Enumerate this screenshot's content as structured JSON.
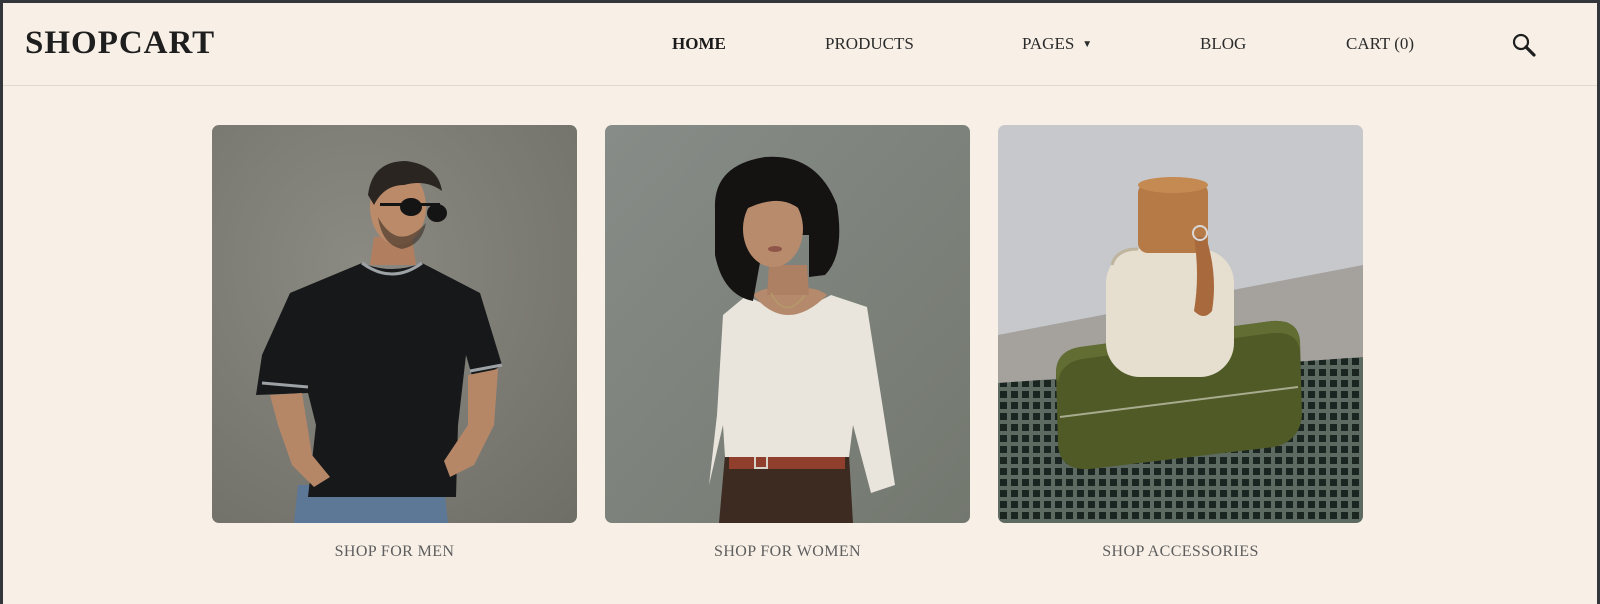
{
  "brand": {
    "logo": "SHOPCART"
  },
  "nav": {
    "home": "HOME",
    "products": "PRODUCTS",
    "pages": "PAGES",
    "pages_caret": "▼",
    "blog": "BLOG",
    "cart": "CART (0)"
  },
  "search": {
    "icon": "search-icon"
  },
  "categories": [
    {
      "label": "SHOP FOR MEN"
    },
    {
      "label": "SHOP FOR WOMEN"
    },
    {
      "label": "SHOP ACCESSORIES"
    }
  ],
  "colors": {
    "background": "#f8f0e7",
    "text": "#1e1e1e",
    "label": "#5e5e5e"
  }
}
